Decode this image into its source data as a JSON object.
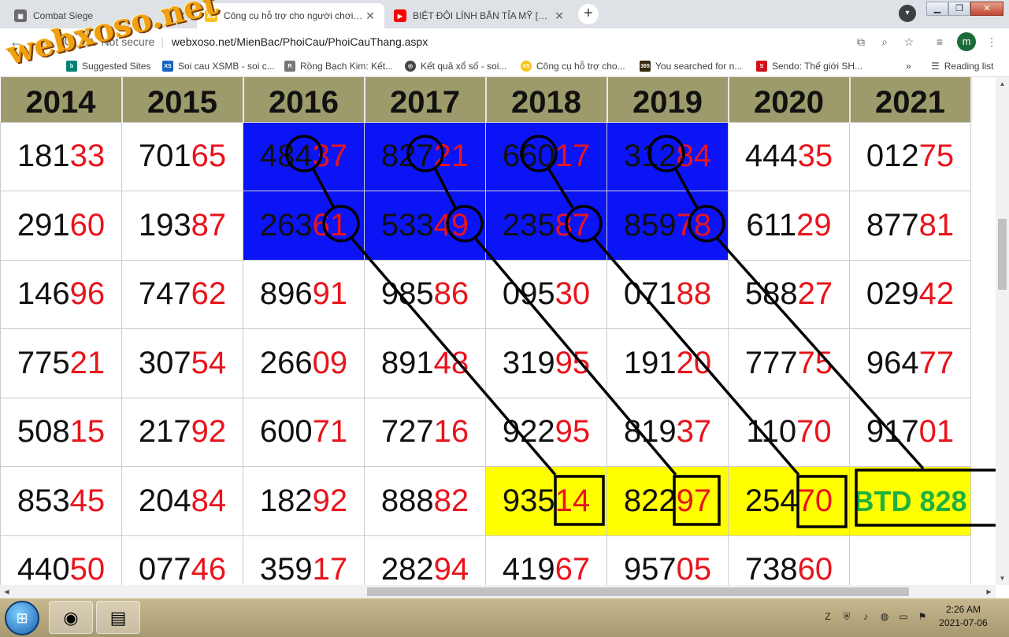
{
  "browser": {
    "tabs": [
      {
        "title": "Combat Siege",
        "icon": "game-icon",
        "color": "#6b6b6b"
      },
      {
        "title": "Công cụ hỗ trợ cho người chơi xổ số",
        "icon": "xs-icon",
        "color": "#f7c21a"
      },
      {
        "title": "BIỆT ĐỘI LÍNH BẮN TỈA MỸ [Thuyết minh]",
        "icon": "youtube-icon",
        "color": "#ff0000"
      }
    ],
    "new_tab": "+",
    "security": "Not secure",
    "url": "webxoso.net/MienBac/PhoiCau/PhoiCauThang.aspx",
    "profile_initial": "m",
    "bookmarks": [
      {
        "label": "Suggested Sites",
        "icon": "bing-icon",
        "color": "#008373"
      },
      {
        "label": "Soi cau XSMB - soi c...",
        "icon": "xs-icon",
        "color": "#1565c0"
      },
      {
        "label": "Rồng Bạch Kim: Kết...",
        "icon": "rbk-icon",
        "color": "#777777"
      },
      {
        "label": "Kết quả xổ số - soi...",
        "icon": "globe-icon",
        "color": "#444444"
      },
      {
        "label": "Công cụ hỗ trợ cho...",
        "icon": "xs-icon",
        "color": "#f7c21a"
      },
      {
        "label": "You searched for n...",
        "icon": "365-icon",
        "color": "#3a2a10"
      },
      {
        "label": "Sendo: Thế giới SH...",
        "icon": "sendo-icon",
        "color": "#d0121b"
      }
    ],
    "reading_list": "Reading list",
    "more_bookmarks": "»"
  },
  "watermark": "webxoso.net",
  "table": {
    "years": [
      "2014",
      "2015",
      "2016",
      "2017",
      "2018",
      "2019",
      "2020",
      "2021"
    ],
    "rows": [
      [
        [
          "181",
          "33"
        ],
        [
          "701",
          "65"
        ],
        [
          "484",
          "37"
        ],
        [
          "827",
          "21"
        ],
        [
          "660",
          "17"
        ],
        [
          "312",
          "84"
        ],
        [
          "444",
          "35"
        ],
        [
          "012",
          "75"
        ]
      ],
      [
        [
          "291",
          "60"
        ],
        [
          "193",
          "87"
        ],
        [
          "263",
          "61"
        ],
        [
          "533",
          "49"
        ],
        [
          "235",
          "87"
        ],
        [
          "859",
          "78"
        ],
        [
          "611",
          "29"
        ],
        [
          "877",
          "81"
        ]
      ],
      [
        [
          "146",
          "96"
        ],
        [
          "747",
          "62"
        ],
        [
          "896",
          "91"
        ],
        [
          "985",
          "86"
        ],
        [
          "095",
          "30"
        ],
        [
          "071",
          "88"
        ],
        [
          "588",
          "27"
        ],
        [
          "029",
          "42"
        ]
      ],
      [
        [
          "775",
          "21"
        ],
        [
          "307",
          "54"
        ],
        [
          "266",
          "09"
        ],
        [
          "891",
          "48"
        ],
        [
          "319",
          "95"
        ],
        [
          "191",
          "20"
        ],
        [
          "777",
          "75"
        ],
        [
          "964",
          "77"
        ]
      ],
      [
        [
          "508",
          "15"
        ],
        [
          "217",
          "92"
        ],
        [
          "600",
          "71"
        ],
        [
          "727",
          "16"
        ],
        [
          "922",
          "95"
        ],
        [
          "819",
          "37"
        ],
        [
          "110",
          "70"
        ],
        [
          "917",
          "01"
        ]
      ],
      [
        [
          "853",
          "45"
        ],
        [
          "204",
          "84"
        ],
        [
          "182",
          "92"
        ],
        [
          "888",
          "82"
        ],
        [
          "935",
          "14"
        ],
        [
          "822",
          "97"
        ],
        [
          "254",
          "70"
        ],
        null
      ],
      [
        [
          "440",
          "50"
        ],
        [
          "077",
          "46"
        ],
        [
          "359",
          "17"
        ],
        [
          "282",
          "94"
        ],
        [
          "419",
          "67"
        ],
        [
          "957",
          "05"
        ],
        [
          "738",
          "60"
        ],
        null
      ]
    ],
    "prediction": "BTD 828",
    "highlight_blue": "#0b14f5",
    "highlight_yellow": "#ffff00",
    "digit_red": "#e8141c",
    "prediction_green": "#1fb040"
  },
  "taskbar": {
    "time": "2:26 AM",
    "date": "2021-07-06",
    "apps": [
      "chrome-icon",
      "file-explorer-icon"
    ]
  }
}
